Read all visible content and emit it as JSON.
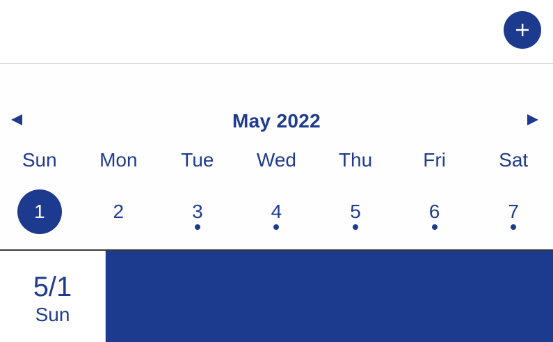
{
  "header": {
    "add_icon": "plus-icon"
  },
  "calendar": {
    "month_title": "May 2022",
    "prev_icon": "triangle-left-icon",
    "next_icon": "triangle-right-icon",
    "weekdays": [
      "Sun",
      "Mon",
      "Tue",
      "Wed",
      "Thu",
      "Fri",
      "Sat"
    ],
    "days": [
      {
        "num": "1",
        "selected": true,
        "has_event": false
      },
      {
        "num": "2",
        "selected": false,
        "has_event": false
      },
      {
        "num": "3",
        "selected": false,
        "has_event": true
      },
      {
        "num": "4",
        "selected": false,
        "has_event": true
      },
      {
        "num": "5",
        "selected": false,
        "has_event": true
      },
      {
        "num": "6",
        "selected": false,
        "has_event": true
      },
      {
        "num": "7",
        "selected": false,
        "has_event": true
      }
    ]
  },
  "selected_day": {
    "date_short": "5/1",
    "weekday": "Sun"
  },
  "colors": {
    "accent": "#1c3a8e",
    "text": "#1f3b8f",
    "background": "#ffffff"
  }
}
